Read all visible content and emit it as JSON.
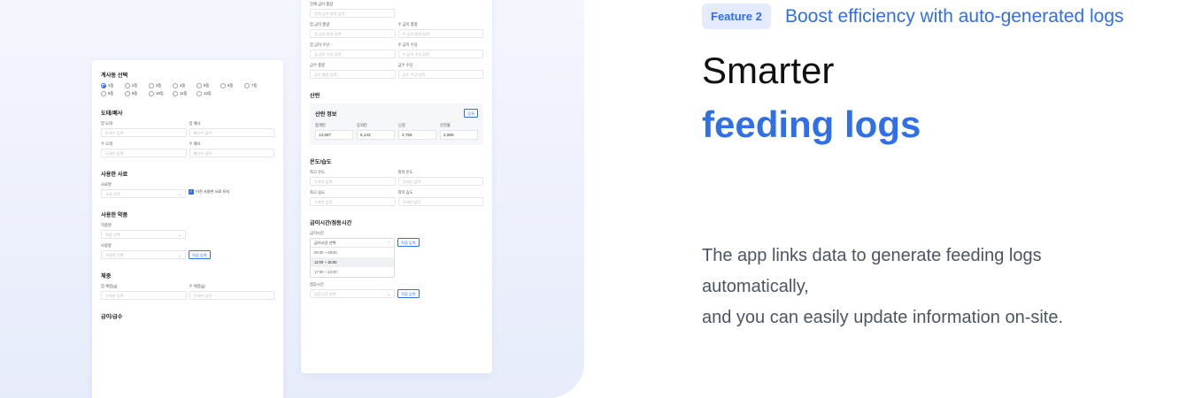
{
  "feature": {
    "badge": "Feature 2",
    "kicker": "Boost efficiency with auto-generated logs"
  },
  "headline": {
    "line1": "Smarter",
    "line2": "feeding logs"
  },
  "description": [
    "The app links data to generate feeding logs",
    "automatically,",
    "and you can easily update information on-site."
  ],
  "left_card": {
    "cage": {
      "title": "계사동 선택",
      "options": [
        "1동",
        "2동",
        "3동",
        "4동",
        "5동",
        "6동",
        "7동",
        "8동",
        "9동",
        "10동",
        "11동",
        "12동"
      ],
      "selected_index": 0
    },
    "culling": {
      "title": "도태/폐사",
      "female_cull": {
        "label": "암 도태",
        "placeholder": "도태수 입력"
      },
      "female_death": {
        "label": "암 폐사",
        "placeholder": "폐사수 입력"
      },
      "male_cull": {
        "label": "수 도태",
        "placeholder": "도태수 입력"
      },
      "male_death": {
        "label": "수 폐사",
        "placeholder": "폐사수 입력"
      }
    },
    "feed": {
      "title": "사용한 사료",
      "label": "사료명",
      "select": "사료 선택",
      "keep_label": "이전 사용한 사료 유지",
      "keep_checked": true
    },
    "medicine": {
      "title": "사용한 약품",
      "name_label": "약품명",
      "name_select": "약품 선택",
      "amount_label": "사용량",
      "amount_select": "사용량 선택",
      "direct_button": "직접 입력"
    },
    "weight": {
      "title": "체중",
      "female": {
        "label": "암 체중(g)",
        "placeholder": "숫자만 입력"
      },
      "male": {
        "label": "수 체중(g)",
        "placeholder": "숫자만 입력"
      }
    },
    "water_title": "급이/급수"
  },
  "right_card": {
    "total_feed": {
      "label": "전체 급이 총량",
      "placeholder": "전체 급이 총량 입력"
    },
    "female_feed_total": {
      "label": "암 급이 총량",
      "placeholder": "암 급이 총량 입력"
    },
    "male_feed_total": {
      "label": "수 급이 총량",
      "placeholder": "수 급이 총량 입력"
    },
    "female_feed_qty": {
      "label": "암 급이 수당",
      "placeholder": "암 급이 수당 입력"
    },
    "male_feed_qty": {
      "label": "수 급이 수당",
      "placeholder": "수 급이 수당 입력"
    },
    "water_total": {
      "label": "급수 총량",
      "placeholder": "급수 총량 입력"
    },
    "water_qty": {
      "label": "급수 수당",
      "placeholder": "급수 수당 입력"
    },
    "laying": {
      "title": "산란",
      "panel_title": "산란 정보",
      "edit_button": "등록",
      "stats": [
        {
          "label": "합계란",
          "value": "13,587"
        },
        {
          "label": "등외란",
          "value": "6,143"
        },
        {
          "label": "난중",
          "value": "4,755"
        },
        {
          "label": "산란율",
          "value": "2,689"
        }
      ]
    },
    "climate": {
      "title": "온도/습도",
      "max_temp": {
        "label": "최고 온도",
        "placeholder": "숫자만 입력"
      },
      "min_temp": {
        "label": "최저 온도",
        "placeholder": "숫자만 입력"
      },
      "max_hum": {
        "label": "최고 습도",
        "placeholder": "숫자만 입력"
      },
      "min_hum": {
        "label": "최저 습도",
        "placeholder": "숫자만 입력"
      }
    },
    "schedule": {
      "title": "급이시간/점등시간",
      "feed_time_label": "급이시간",
      "feed_time_select": "급이시간 선택",
      "options": [
        "06:00 ~ 09:00",
        "11:00 ~ 15:00",
        "17:00 ~ 22:00"
      ],
      "highlight_index": 1,
      "direct_button": "직접 입력",
      "light_label": "점등시간",
      "light_select": "점등시간 선택",
      "light_button": "직접 입력"
    }
  }
}
